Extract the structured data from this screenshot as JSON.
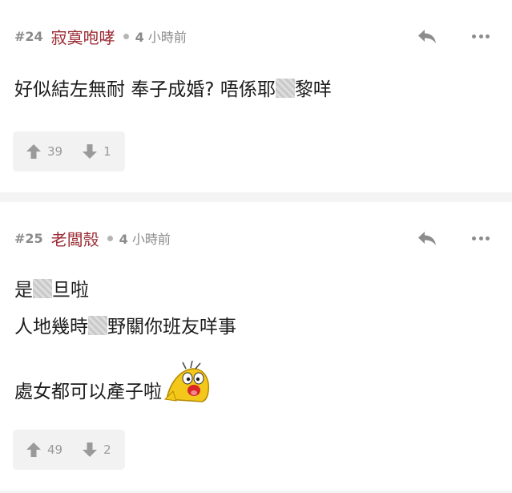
{
  "replies": [
    {
      "floor": "#24",
      "username": "寂寞咆哮",
      "time_num": "4",
      "time_unit": "小時前",
      "lines": [
        {
          "before": "好似結左無耐 奉子成婚? 唔係耶",
          "after": "黎咩"
        }
      ],
      "upvotes": "39",
      "downvotes": "1"
    },
    {
      "floor": "#25",
      "username": "老闆殼",
      "time_num": "4",
      "time_unit": "小時前",
      "lines": [
        {
          "before": "是",
          "after": "旦啦"
        },
        {
          "before": "人地幾時",
          "after": "野關你班友咩事"
        },
        {
          "text": "處女都可以產子啦"
        }
      ],
      "upvotes": "49",
      "downvotes": "2"
    }
  ],
  "colors": {
    "username": "#9b2a33",
    "meta_gray": "#8a8a8a",
    "vote_box_bg": "#f2f2f2",
    "page_bg": "#f4f4f4"
  },
  "icons": {
    "reply": "reply-arrow-icon",
    "more": "more-dots-icon",
    "upvote": "arrow-up-icon",
    "downvote": "arrow-down-icon",
    "emoji": "laughing-chick-emoji"
  }
}
